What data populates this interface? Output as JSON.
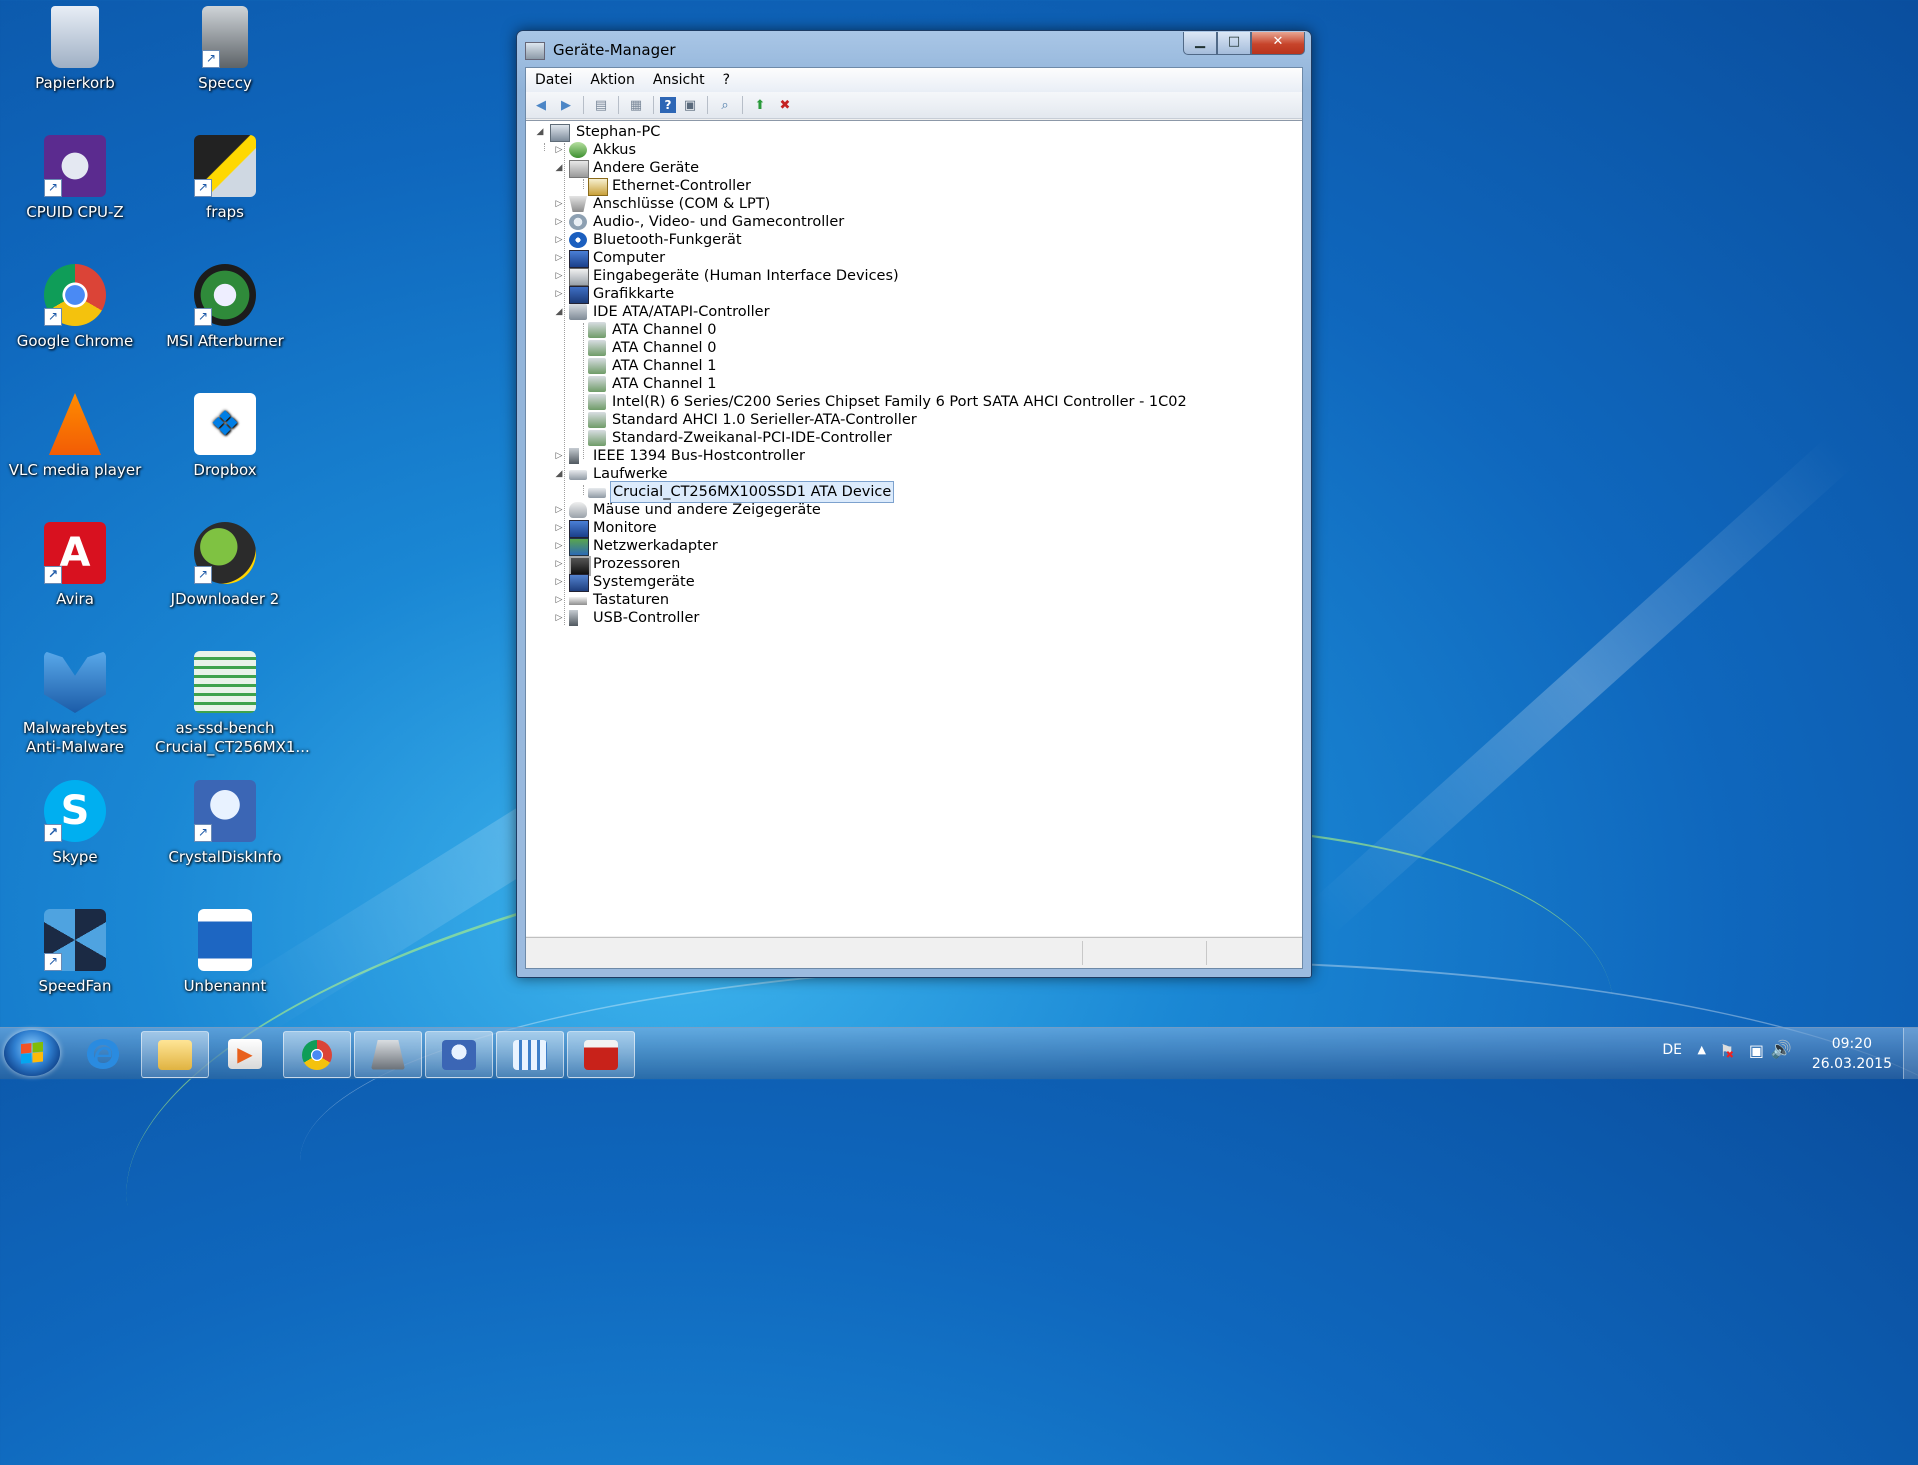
{
  "desktop": {
    "icons": [
      {
        "label": "Papierkorb",
        "icon": "recycle-bin-icon"
      },
      {
        "label": "Speccy",
        "icon": "speccy-icon"
      },
      {
        "label": "CPUID CPU-Z",
        "icon": "cpuz-icon"
      },
      {
        "label": "fraps",
        "icon": "fraps-icon"
      },
      {
        "label": "Google Chrome",
        "icon": "chrome-icon"
      },
      {
        "label": "MSI Afterburner",
        "icon": "msi-afterburner-icon"
      },
      {
        "label": "VLC media player",
        "icon": "vlc-icon"
      },
      {
        "label": "Dropbox",
        "icon": "dropbox-icon"
      },
      {
        "label": "Avira",
        "icon": "avira-icon"
      },
      {
        "label": "JDownloader 2",
        "icon": "jdownloader-icon"
      },
      {
        "label": "Malwarebytes Anti-Malware",
        "icon": "malwarebytes-icon"
      },
      {
        "label": "as-ssd-bench Crucial_CT256MX1...",
        "icon": "as-ssd-icon"
      },
      {
        "label": "Skype",
        "icon": "skype-icon"
      },
      {
        "label": "CrystalDiskInfo",
        "icon": "crystaldiskinfo-icon"
      },
      {
        "label": "SpeedFan",
        "icon": "speedfan-icon"
      },
      {
        "label": "Unbenannt",
        "icon": "document-icon"
      }
    ]
  },
  "window": {
    "title": "Geräte-Manager",
    "buttons": {
      "minimize": "▁",
      "maximize": "□",
      "close": "✕"
    },
    "menu": [
      "Datei",
      "Aktion",
      "Ansicht",
      "?"
    ],
    "toolbar": [
      "back-icon",
      "forward-icon",
      "show-hide-console-tree-icon",
      "properties-icon",
      "help-icon",
      "view-icon",
      "scan-hardware-icon",
      "update-driver-icon",
      "uninstall-icon"
    ],
    "tree": {
      "root": "Stephan-PC",
      "items": [
        {
          "label": "Akkus"
        },
        {
          "label": "Andere Geräte"
        },
        {
          "label": "Ethernet-Controller"
        },
        {
          "label": "Anschlüsse (COM & LPT)"
        },
        {
          "label": "Audio-, Video- und Gamecontroller"
        },
        {
          "label": "Bluetooth-Funkgerät"
        },
        {
          "label": "Computer"
        },
        {
          "label": "Eingabegeräte (Human Interface Devices)"
        },
        {
          "label": "Grafikkarte"
        },
        {
          "label": "IDE ATA/ATAPI-Controller"
        },
        {
          "label": "ATA Channel 0"
        },
        {
          "label": "ATA Channel 0"
        },
        {
          "label": "ATA Channel 1"
        },
        {
          "label": "ATA Channel 1"
        },
        {
          "label": "Intel(R) 6 Series/C200 Series Chipset Family 6 Port SATA AHCI Controller - 1C02"
        },
        {
          "label": "Standard AHCI 1.0 Serieller-ATA-Controller"
        },
        {
          "label": "Standard-Zweikanal-PCI-IDE-Controller"
        },
        {
          "label": "IEEE 1394 Bus-Hostcontroller"
        },
        {
          "label": "Laufwerke"
        },
        {
          "label": "Crucial_CT256MX100SSD1 ATA Device"
        },
        {
          "label": "Mäuse und andere Zeigegeräte"
        },
        {
          "label": "Monitore"
        },
        {
          "label": "Netzwerkadapter"
        },
        {
          "label": "Prozessoren"
        },
        {
          "label": "Systemgeräte"
        },
        {
          "label": "Tastaturen"
        },
        {
          "label": "USB-Controller"
        }
      ],
      "selected": "Crucial_CT256MX100SSD1 ATA Device"
    }
  },
  "taskbar": {
    "pinned": [
      "internet-explorer-icon",
      "explorer-icon",
      "media-player-icon",
      "chrome-icon",
      "speccy-icon",
      "crystaldiskinfo-icon",
      "as-ssd-icon",
      "device-manager-icon"
    ],
    "language": "DE",
    "time": "09:20",
    "date": "26.03.2015"
  },
  "colors": {
    "selection": "#dcebfc",
    "selection_border": "#7da2ce",
    "titlebar": "#a9c6e6"
  }
}
